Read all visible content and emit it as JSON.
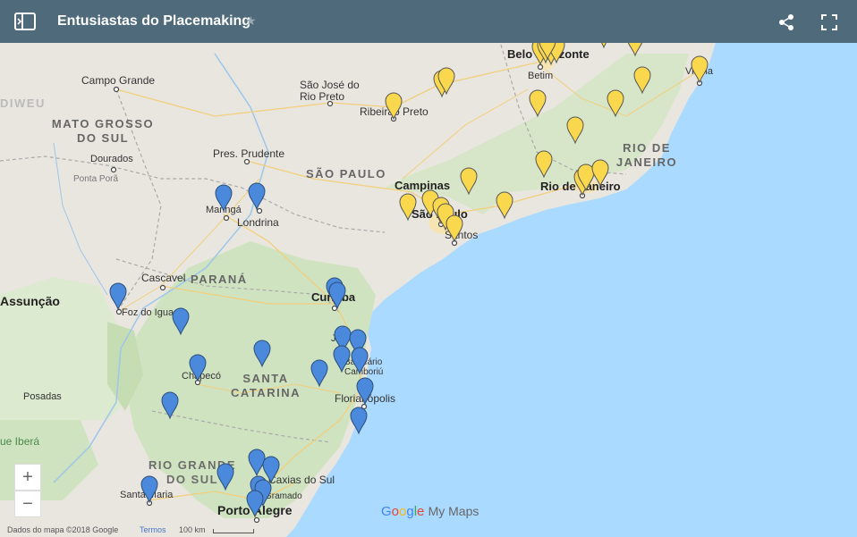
{
  "header": {
    "title": "Entusiastas do Placemaking",
    "star_icon": "star-icon",
    "share_icon": "share-icon",
    "fullscreen_icon": "fullscreen-icon"
  },
  "labels": {
    "belo_horizonte": "Belo Horizonte",
    "betim": "Betim",
    "vitoria": "Vitória",
    "campo_grande": "Campo Grande",
    "sao_jose_rio_preto": "São José do Rio Preto",
    "ribeirao_preto": "Ribeirão Preto",
    "mato_grosso_do_sul": "MATO GROSSO DO SUL",
    "dourados": "Dourados",
    "ponta_pora": "Ponta Porã",
    "pres_prudente": "Pres. Prudente",
    "sao_paulo_state": "SÃO PAULO",
    "rio_de_janeiro_state": "RIO DE JANEIRO",
    "campinas": "Campinas",
    "sao_paulo": "São Paulo",
    "santos": "Santos",
    "rio_de_janeiro": "Rio de Janeiro",
    "maringa": "Maringá",
    "londrina": "Londrina",
    "cascavel": "Cascavel",
    "parana": "PARANÁ",
    "assuncao": "Assunção",
    "foz_do_iguacu": "Foz do Iguaçu",
    "curitiba": "Curitiba",
    "joinville": "Joinville",
    "balneario_camboriu": "Balneário Camboriú",
    "chapeco": "Chapecó",
    "santa_catarina": "SANTA CATARINA",
    "florianopolis": "Florianópolis",
    "posadas": "Posadas",
    "ibera": "ue Iberá",
    "rio_grande_do_sul": "RIO GRANDE DO SUL",
    "caxias_do_sul": "Caxias do Sul",
    "gramado": "Gramado",
    "santa_maria": "Santa Maria",
    "porto_alegre": "Porto Alegre",
    "idwey": "DIWEU"
  },
  "zoom": {
    "in": "+",
    "out": "−"
  },
  "footer": {
    "map_data": "Dados do mapa ©2018 Google",
    "terms": "Termos",
    "scale": "100 km"
  },
  "logo": {
    "google": "Google",
    "mymaps": "My Maps"
  },
  "colors": {
    "yellow_pin": "#f9d84e",
    "blue_pin": "#4a89dc",
    "header": "#4e6a7b",
    "sea": "#aadaff"
  }
}
